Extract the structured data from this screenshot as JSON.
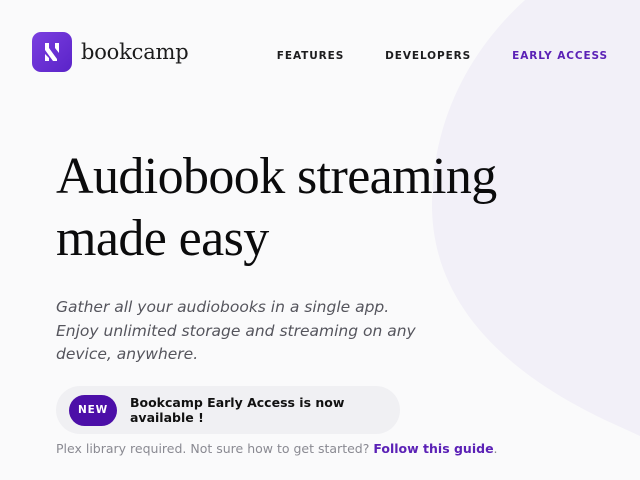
{
  "brand": {
    "name": "bookcamp",
    "accent_color": "#5b21b6",
    "logo_icon": "bookcamp-logo-icon"
  },
  "nav": {
    "items": [
      {
        "label": "FEATURES"
      },
      {
        "label": "DEVELOPERS"
      },
      {
        "label": "EARLY ACCESS"
      }
    ],
    "active_index": 2
  },
  "hero": {
    "title_line1": "Audiobook streaming",
    "title_line2": "made easy",
    "subtitle": "Gather all your audiobooks in a single app. Enjoy unlimited storage and streaming on any device, anywhere."
  },
  "announcement": {
    "badge": "NEW",
    "text": "Bookcamp Early Access is now available !",
    "badge_color": "#4c0fa8"
  },
  "footnote": {
    "text": "Plex library required. Not sure how to get started?",
    "link_label": "Follow this guide",
    "trailing": "."
  }
}
